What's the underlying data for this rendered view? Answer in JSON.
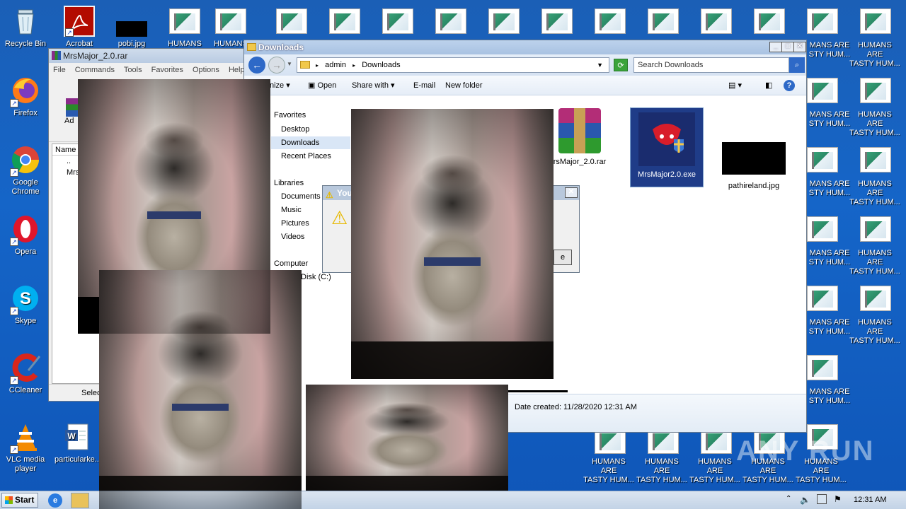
{
  "desktop": {
    "icons_left": [
      {
        "label": "Recycle Bin",
        "icon": "recycle-bin-icon"
      },
      {
        "label": "Firefox",
        "icon": "firefox-icon"
      },
      {
        "label": "Google Chrome",
        "icon": "chrome-icon"
      },
      {
        "label": "Opera",
        "icon": "opera-icon"
      },
      {
        "label": "Skype",
        "icon": "skype-icon"
      },
      {
        "label": "CCleaner",
        "icon": "ccleaner-icon"
      },
      {
        "label": "VLC media player",
        "icon": "vlc-icon"
      }
    ],
    "icons_top": [
      {
        "label": "Acrobat",
        "icon": "acrobat-icon"
      },
      {
        "label": "pobi.jpg",
        "icon": "image-file-icon"
      },
      {
        "label": "HUMANS ARE",
        "icon": "image-file-icon"
      },
      {
        "label": "HUMANS",
        "icon": "image-file-icon"
      }
    ],
    "particular_label": "particularke...",
    "humans_two_line": [
      "HUMANS ARE",
      "TASTY HUM..."
    ],
    "humans_edge": [
      "MANS ARE",
      "STY HUM..."
    ],
    "watermark": "ANY RUN"
  },
  "winrar": {
    "title": "MrsMajor_2.0.rar",
    "menu": [
      "File",
      "Commands",
      "Tools",
      "Favorites",
      "Options",
      "Help"
    ],
    "toolbar_partial": "Ad",
    "col_name": "Name",
    "row1": "..",
    "row2": "Mrs",
    "status": "Selec"
  },
  "explorer": {
    "title": "Downloads",
    "breadcrumb": [
      "admin",
      "Downloads"
    ],
    "search_placeholder": "Search Downloads",
    "toolbar": {
      "organize": "nize",
      "open": "Open",
      "share": "Share with",
      "email": "E-mail",
      "new_folder": "New folder"
    },
    "nav": {
      "favorites": "Favorites",
      "desktop": "Desktop",
      "downloads": "Downloads",
      "recent": "Recent Places",
      "libraries": "Libraries",
      "documents": "Documents",
      "music": "Music",
      "pictures": "Pictures",
      "videos": "Videos",
      "computer": "Computer",
      "disk": "Disk (C:)"
    },
    "files": [
      {
        "name": "rsMajor_2.0.rar",
        "icon": "winrar-archive-icon"
      },
      {
        "name": "MrsMajor2.0.exe",
        "icon": "exe-shield-icon"
      },
      {
        "name": "pathireland.jpg",
        "icon": "image-file-icon"
      }
    ],
    "details_date": "Date created: 11/28/2020 12:31 AM"
  },
  "dialog": {
    "title_partial": "You",
    "button_partial": "e"
  },
  "taskbar": {
    "start": "Start",
    "time": "12:31 AM"
  }
}
